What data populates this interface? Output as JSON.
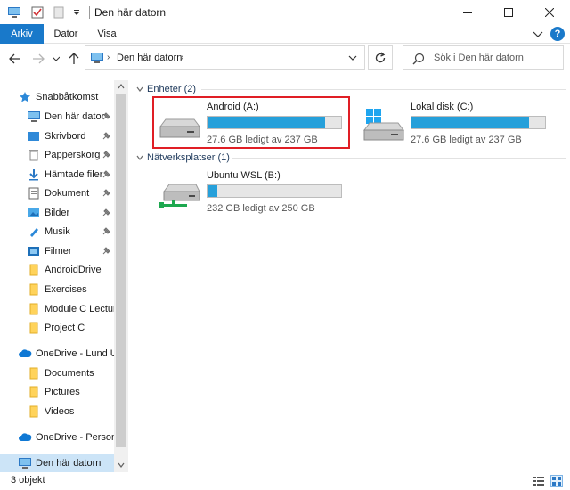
{
  "window": {
    "title": "Den här datorn"
  },
  "ribbon": {
    "tabs": [
      "Arkiv",
      "Dator",
      "Visa"
    ]
  },
  "nav": {
    "address_path": "Den här datorn",
    "search_placeholder": "Sök i Den här datorn"
  },
  "sidebar": {
    "items": [
      {
        "label": "Snabbåtkomst",
        "icon": "star-icon",
        "pinned": false
      },
      {
        "label": "Den här dator",
        "icon": "computer-icon",
        "pinned": true
      },
      {
        "label": "Skrivbord",
        "icon": "desktop-folder-icon",
        "pinned": true
      },
      {
        "label": "Papperskorg",
        "icon": "recycle-bin-icon",
        "pinned": true
      },
      {
        "label": "Hämtade filer",
        "icon": "download-icon",
        "pinned": true
      },
      {
        "label": "Dokument",
        "icon": "document-icon",
        "pinned": true
      },
      {
        "label": "Bilder",
        "icon": "pictures-icon",
        "pinned": true
      },
      {
        "label": "Musik",
        "icon": "music-icon",
        "pinned": true
      },
      {
        "label": "Filmer",
        "icon": "video-icon",
        "pinned": true
      },
      {
        "label": "AndroidDrive",
        "icon": "folder-icon",
        "pinned": false
      },
      {
        "label": "Exercises",
        "icon": "folder-icon",
        "pinned": false
      },
      {
        "label": "Module C Lecture",
        "icon": "folder-icon",
        "pinned": false
      },
      {
        "label": "Project C",
        "icon": "folder-icon",
        "pinned": false
      },
      {
        "label": "OneDrive - Lund U",
        "icon": "onedrive-icon",
        "pinned": false
      },
      {
        "label": "Documents",
        "icon": "folder-icon",
        "pinned": false
      },
      {
        "label": "Pictures",
        "icon": "folder-icon",
        "pinned": false
      },
      {
        "label": "Videos",
        "icon": "folder-icon",
        "pinned": false
      },
      {
        "label": "OneDrive - Person",
        "icon": "onedrive-icon",
        "pinned": false
      },
      {
        "label": "Den här datorn",
        "icon": "computer-icon",
        "pinned": false,
        "selected": true
      }
    ]
  },
  "content": {
    "groups": [
      {
        "header": "Enheter (2)",
        "drives": [
          {
            "name": "Android (A:)",
            "free_text": "27.6 GB ledigt av 237 GB",
            "used_fraction": 0.88,
            "icon": "hard-drive-icon",
            "highlighted": true
          },
          {
            "name": "Lokal disk (C:)",
            "free_text": "27.6 GB ledigt av 237 GB",
            "used_fraction": 0.88,
            "icon": "windows-drive-icon",
            "highlighted": false
          }
        ]
      },
      {
        "header": "Nätverksplatser (1)",
        "drives": [
          {
            "name": "Ubuntu WSL (B:)",
            "free_text": "232 GB ledigt av 250 GB",
            "used_fraction": 0.07,
            "icon": "network-drive-icon",
            "highlighted": false
          }
        ]
      }
    ]
  },
  "status": {
    "text": "3 objekt"
  },
  "colors": {
    "accent": "#1979ca",
    "bar_fill": "#26a0da",
    "highlight": "#e01e25",
    "selected_bg": "#cce4f7"
  }
}
